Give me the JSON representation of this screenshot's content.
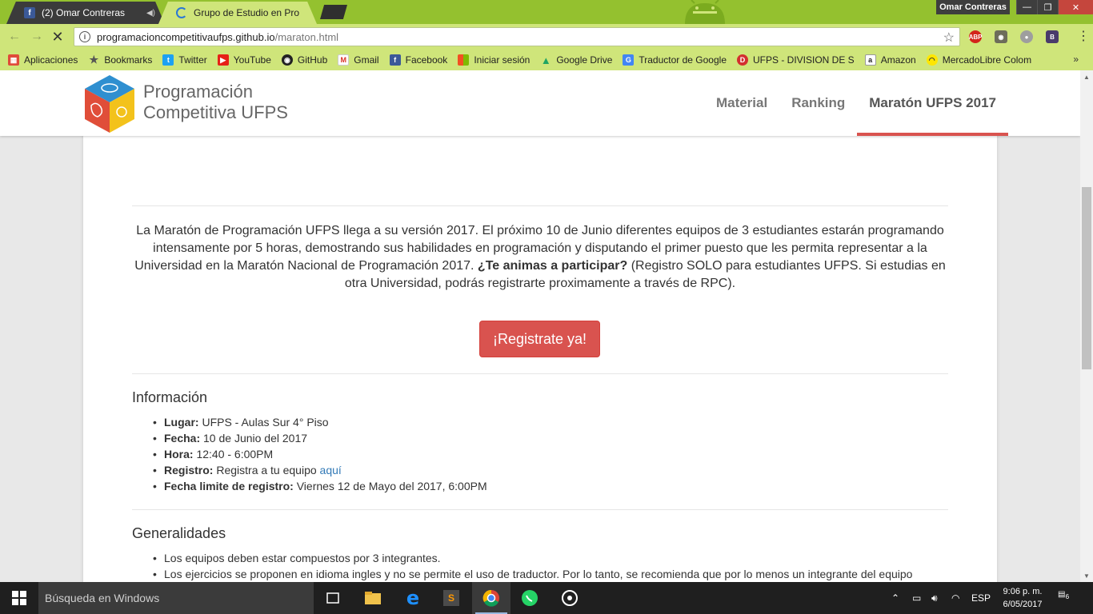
{
  "browser": {
    "tabs": [
      {
        "title": "(2) Omar Contreras",
        "favicon": "facebook-icon",
        "extra": "mute-icon",
        "active": false
      },
      {
        "title": "Grupo de Estudio en Pro",
        "favicon": "loading-icon",
        "active": true
      }
    ],
    "profile_name": "Omar Contreras",
    "url_host": "programacioncompetitivaufps.github.io",
    "url_path": "/maraton.html",
    "bookmarks": [
      {
        "label": "Aplicaciones",
        "icon": "apps-grid-icon",
        "color": "#e04b3a"
      },
      {
        "label": "Bookmarks",
        "icon": "star-icon",
        "color": "#555555"
      },
      {
        "label": "Twitter",
        "icon": "twitter-icon",
        "color": "#1da1f2"
      },
      {
        "label": "YouTube",
        "icon": "youtube-icon",
        "color": "#e62117"
      },
      {
        "label": "GitHub",
        "icon": "github-icon",
        "color": "#222222"
      },
      {
        "label": "Gmail",
        "icon": "gmail-icon",
        "color": "#d93025"
      },
      {
        "label": "Facebook",
        "icon": "facebook-icon",
        "color": "#3b5998"
      },
      {
        "label": "Iniciar sesión",
        "icon": "microsoft-icon",
        "color": "#f25022"
      },
      {
        "label": "Google Drive",
        "icon": "drive-icon",
        "color": "#1fa463"
      },
      {
        "label": "Traductor de Google",
        "icon": "translate-icon",
        "color": "#4285f4"
      },
      {
        "label": "UFPS - DIVISION DE S",
        "icon": "ufps-icon",
        "color": "#d32f2f"
      },
      {
        "label": "Amazon",
        "icon": "amazon-icon",
        "color": "#222222"
      },
      {
        "label": "MercadoLibre Colom",
        "icon": "mercadolibre-icon",
        "color": "#ffe600"
      }
    ]
  },
  "site": {
    "brand_line1": "Programación",
    "brand_line2": "Competitiva UFPS",
    "nav": [
      {
        "label": "Material",
        "active": false
      },
      {
        "label": "Ranking",
        "active": false
      },
      {
        "label": "Maratón UFPS 2017",
        "active": true
      }
    ],
    "accent_color": "#d9534f"
  },
  "content": {
    "intro_part1": "La Maratón de Programación UFPS llega a su versión 2017. El próximo 10 de Junio diferentes equipos de 3 estudiantes estarán programando intensamente por 5 horas, demostrando sus habilidades en programación y disputando el primer puesto que les permita representar a la Universidad en la Maratón Nacional de Programación 2017.",
    "intro_bold": "¿Te animas a participar?",
    "intro_part2": "(Registro SOLO para estudiantes UFPS. Si estudias en otra Universidad, podrás registrarte proximamente a través de RPC).",
    "cta_label": "¡Registrate ya!",
    "info_title": "Información",
    "info_items": [
      {
        "label": "Lugar:",
        "value": "UFPS - Aulas Sur 4° Piso"
      },
      {
        "label": "Fecha:",
        "value": "10 de Junio del 2017"
      },
      {
        "label": "Hora:",
        "value": "12:40 - 6:00PM"
      },
      {
        "label": "Registro:",
        "value": "Registra a tu equipo",
        "link": "aquí"
      },
      {
        "label": "Fecha limite de registro:",
        "value": "Viernes 12 de Mayo del 2017, 6:00PM"
      }
    ],
    "general_title": "Generalidades",
    "general_items": [
      "Los equipos deben estar compuestos por 3 integrantes.",
      "Los ejercicios se proponen en idioma ingles y no se permite el uso de traductor. Por lo tanto, se recomienda que por lo menos un integrante del equipo"
    ]
  },
  "taskbar": {
    "search_placeholder": "Búsqueda en Windows",
    "language": "ESP",
    "time": "9:06 p. m.",
    "date": "6/05/2017",
    "notifications": "6"
  }
}
